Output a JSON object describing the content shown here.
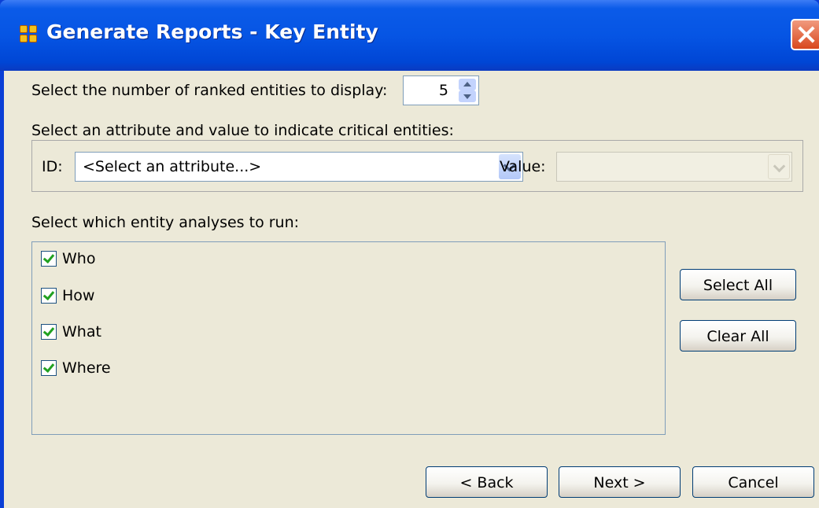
{
  "window": {
    "title": "Generate Reports - Key Entity"
  },
  "ranked": {
    "label": "Select the number of ranked entities to display:",
    "value": "5"
  },
  "attribute": {
    "label": "Select an attribute and value to indicate critical entities:",
    "id_label": "ID:",
    "id_value": "<Select an attribute...>",
    "value_label": "Value:",
    "value_value": ""
  },
  "analyses": {
    "label": "Select which entity analyses to run:",
    "items": [
      {
        "label": "Who",
        "checked": true
      },
      {
        "label": "How",
        "checked": true
      },
      {
        "label": "What",
        "checked": true
      },
      {
        "label": "Where",
        "checked": true
      }
    ]
  },
  "buttons": {
    "select_all": "Select All",
    "clear_all": "Clear All",
    "back": "< Back",
    "next": "Next >",
    "cancel": "Cancel"
  },
  "colors": {
    "titlebar": "#0655e4",
    "dialog": "#ece9d8",
    "check": "#21a121",
    "close": "#d8471d"
  }
}
